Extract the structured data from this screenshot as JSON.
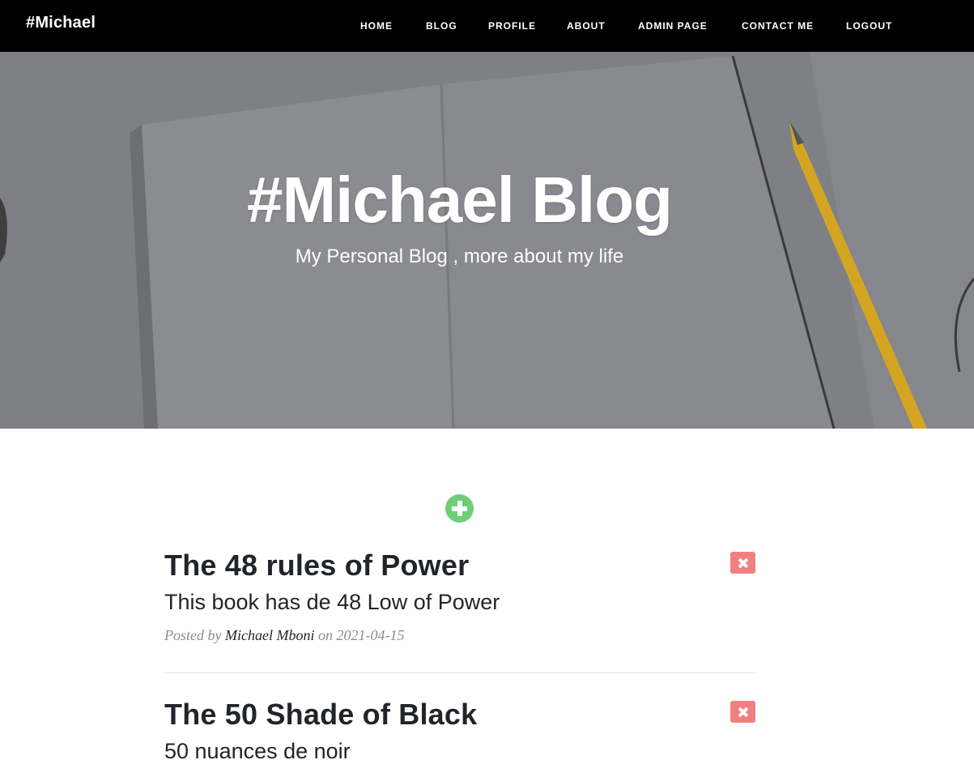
{
  "navbar": {
    "brand": "#Michael",
    "links": [
      {
        "label": "HOME"
      },
      {
        "label": "BLOG"
      },
      {
        "label": "PROFILE"
      },
      {
        "label": "ABOUT"
      },
      {
        "label": "ADMIN PAGE"
      },
      {
        "label": "CONTACT ME"
      },
      {
        "label": "LOGOUT"
      }
    ]
  },
  "hero": {
    "title": "#Michael Blog",
    "subtitle": "My Personal Blog , more about my life"
  },
  "actions": {
    "add_icon": "plus-circle-icon",
    "delete_icon": "times-icon"
  },
  "posts": [
    {
      "title": "The 48 rules of Power",
      "subtitle": "This book has de 48 Low of Power",
      "meta_prefix": "Posted by ",
      "author": "Michael Mboni",
      "meta_on": " on ",
      "date": "2021-04-15"
    },
    {
      "title": "The 50 Shade of Black",
      "subtitle": "50 nuances de noir"
    }
  ],
  "colors": {
    "navbar_bg": "#000000",
    "add_button": "#6fcf76",
    "delete_button": "#f08080",
    "text_dark": "#212529",
    "text_muted": "#868e96"
  }
}
